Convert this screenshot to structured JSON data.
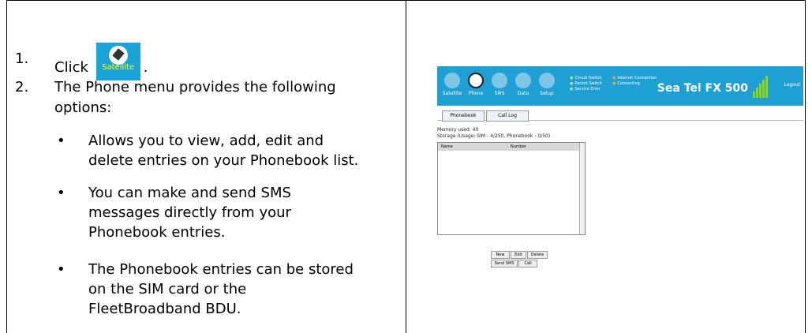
{
  "steps": [
    {
      "num": "1.",
      "text": "Click"
    },
    {
      "num": "2.",
      "text_line1": "The Phone menu provides the following",
      "text_line2": "options:"
    }
  ],
  "satellite_button": {
    "label": "Satellite",
    "icon": "satellite-icon"
  },
  "bullets": [
    {
      "lines": [
        "Allows you to view, add, edit and",
        "delete entries on your Phonebook list."
      ]
    },
    {
      "lines": [
        "You can make and send SMS",
        "messages directly from your",
        "Phonebook entries."
      ]
    },
    {
      "lines": [
        "The Phonebook entries can be stored",
        "on the SIM card or the",
        "FleetBroadband BDU."
      ]
    }
  ],
  "screenshot": {
    "nav": [
      "Satellite",
      "Phone",
      "SMS",
      "Data",
      "Setup"
    ],
    "status": [
      "Circuit Switch",
      "Packet Switch",
      "Service Error",
      "Internet Connection",
      "Connecting"
    ],
    "brand": "Sea Tel FX 500",
    "header_right": "Logout",
    "tabs": [
      "Phonebook",
      "Call Log"
    ],
    "info_line1": "Memory used: 40",
    "info_line2": "Storage (Usage: SIM - 4/250, Phonebook - 0/50)",
    "columns": [
      "Name",
      "Number"
    ],
    "buttons_row1": [
      "New",
      "Edit",
      "Delete"
    ],
    "buttons_row2": [
      "Send SMS",
      "Call"
    ]
  },
  "colors": {
    "header_bg": "#1ea0d5",
    "signal": "#7dd34a"
  }
}
